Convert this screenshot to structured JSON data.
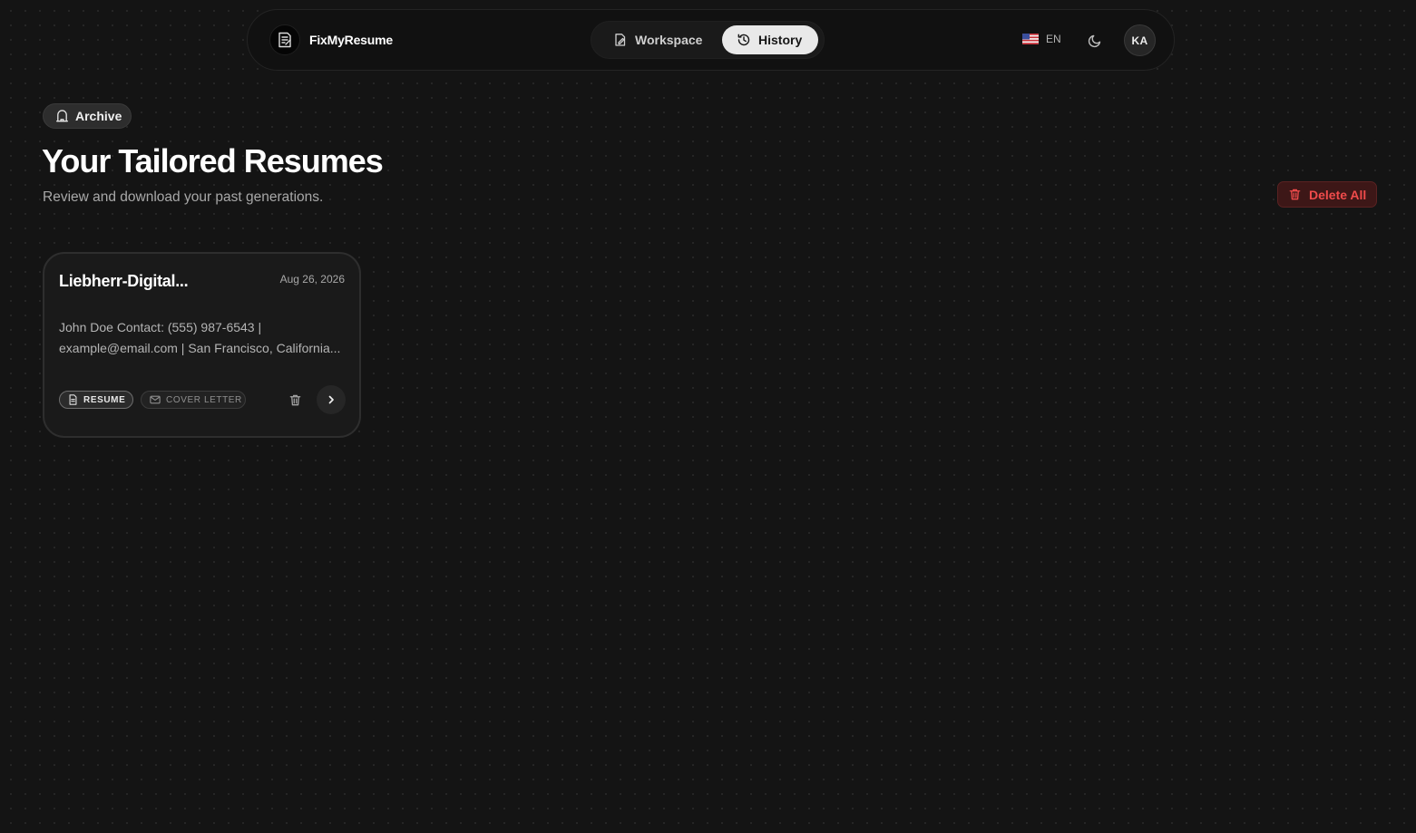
{
  "app": {
    "name": "FixMyResume"
  },
  "nav": {
    "items": [
      {
        "label": "Workspace",
        "icon": "file-edit-icon",
        "active": false
      },
      {
        "label": "History",
        "icon": "history-icon",
        "active": true
      }
    ]
  },
  "header": {
    "language": "EN",
    "language_flag": "us-flag-icon",
    "theme_icon": "moon-icon",
    "avatar_initials": "KA"
  },
  "page": {
    "badge": "Archive",
    "title": "Your Tailored Resumes",
    "subtitle": "Review and download your past generations.",
    "delete_all_label": "Delete All"
  },
  "cards": [
    {
      "title": "Liebherr-Digital...",
      "date": "Aug 26, 2026",
      "preview_line1": "John Doe Contact: (555) 987-6543 |",
      "preview_line2": "example@email.com | San Francisco, California...",
      "tags": [
        "RESUME",
        "COVER LETTER"
      ]
    }
  ],
  "colors": {
    "background": "#141414",
    "accent_danger": "#f04b4b",
    "active_tab": "#e9e9e9"
  }
}
